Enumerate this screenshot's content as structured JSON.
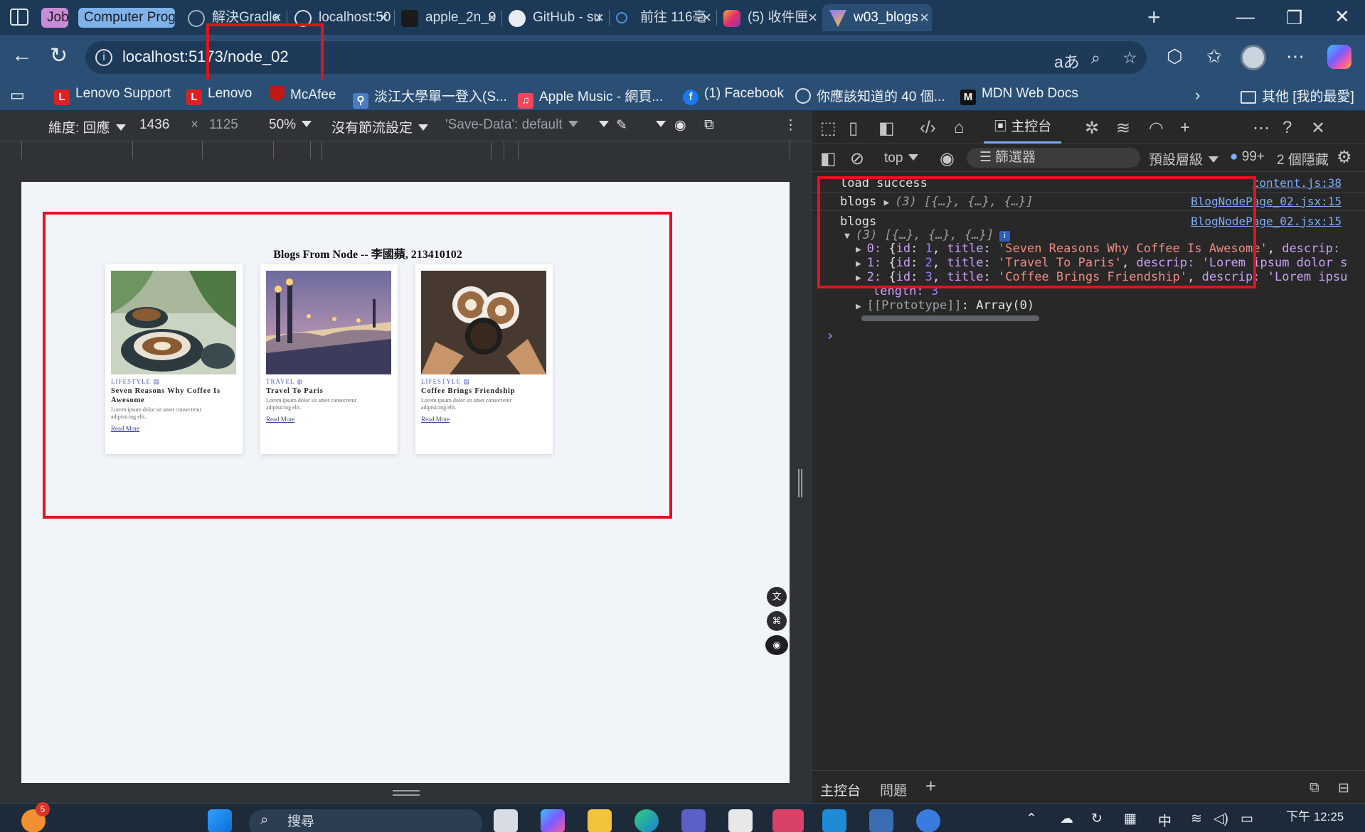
{
  "browser": {
    "tab_groups": [
      {
        "label": "Job",
        "color": "#c98bd8"
      },
      {
        "label": "Computer Program",
        "color": "#7fb2ea"
      }
    ],
    "tabs": [
      {
        "title": "解決Gradle",
        "icon": "chatgpt-icon"
      },
      {
        "title": "localhost:50",
        "icon": "globe-icon"
      },
      {
        "title": "apple_2n_0",
        "icon": "vite-dev-icon"
      },
      {
        "title": "GitHub - su",
        "icon": "github-icon"
      },
      {
        "title": "前往 116毫",
        "icon": "search-icon"
      },
      {
        "title": "(5) 收件匣",
        "icon": "instagram-icon"
      },
      {
        "title": "w03_blogs",
        "icon": "vite-icon",
        "active": true
      }
    ],
    "url": "localhost:5173/node_02",
    "highlight_color": "#e0141e"
  },
  "bookmarks": [
    {
      "label": "Lenovo Support",
      "icon": "lenovo-icon"
    },
    {
      "label": "Lenovo",
      "icon": "lenovo-icon"
    },
    {
      "label": "McAfee",
      "icon": "mcafee-icon"
    },
    {
      "label": "淡江大學單一登入(S...",
      "icon": "tku-icon"
    },
    {
      "label": "Apple Music - 網頁...",
      "icon": "apple-music-icon"
    },
    {
      "label": "(1) Facebook",
      "icon": "facebook-icon"
    },
    {
      "label": "你應該知道的 40 個...",
      "icon": "globe-icon"
    },
    {
      "label": "MDN Web Docs",
      "icon": "mdn-icon"
    }
  ],
  "bookmarks_other": "其他 [我的最愛]",
  "device_toolbar": {
    "dimension_label": "維度: 回應",
    "width": "1436",
    "height": "1125",
    "zoom": "50%",
    "throttle": "沒有節流設定",
    "save_data": "'Save-Data': default"
  },
  "page": {
    "heading": "Blogs From Node -- 李國蘋, 213410102",
    "cards": [
      {
        "category": "LIFESTYLE",
        "title": "Seven Reasons Why Coffee Is Awesome",
        "description": "Lorem ipsum dolor sit amet consectetur adipisicing elit.",
        "read_more": "Read More"
      },
      {
        "category": "TRAVEL",
        "title": "Travel To Paris",
        "description": "Lorem ipsum dolor sit amet consectetur adipisicing elit.",
        "read_more": "Read More"
      },
      {
        "category": "LIFESTYLE",
        "title": "Coffee Brings Friendship",
        "description": "Lorem ipsum dolor sit amet consectetur adipisicing elit.",
        "read_more": "Read More"
      }
    ]
  },
  "devtools": {
    "console_tab": "主控台",
    "context": "top",
    "filter_placeholder": "篩選器",
    "levels": "預設層級",
    "issues_count": "99+",
    "hidden": "2 個隱藏",
    "logs": [
      {
        "text": "load success",
        "source": "content.js:38"
      },
      {
        "text": "blogs",
        "preview": "(3) [{…}, {…}, {…}]",
        "source": "BlogNodePage_02.jsx:15"
      },
      {
        "text": "blogs",
        "preview": "(3) [{…}, {…}, {…}]",
        "source": "BlogNodePage_02.jsx:15"
      }
    ],
    "array_items": [
      {
        "index": "0",
        "id": "1",
        "title": "'Seven Reasons Why Coffee Is Awesome'",
        "rest": "descrip:"
      },
      {
        "index": "1",
        "id": "2",
        "title": "'Travel To Paris'",
        "rest": "descrip: 'Lorem ipsum dolor s"
      },
      {
        "index": "2",
        "id": "3",
        "title": "'Coffee Brings Friendship'",
        "rest": "descrip: 'Lorem ipsu"
      }
    ],
    "length_label": "length",
    "length_value": "3",
    "prototype_label": "[[Prototype]]",
    "prototype_value": "Array(0)",
    "drawer_tabs": [
      "主控台",
      "問題"
    ]
  },
  "taskbar": {
    "notification_count": "5",
    "search_placeholder": "搜尋",
    "time": "下午 12:25",
    "ime": "中"
  }
}
